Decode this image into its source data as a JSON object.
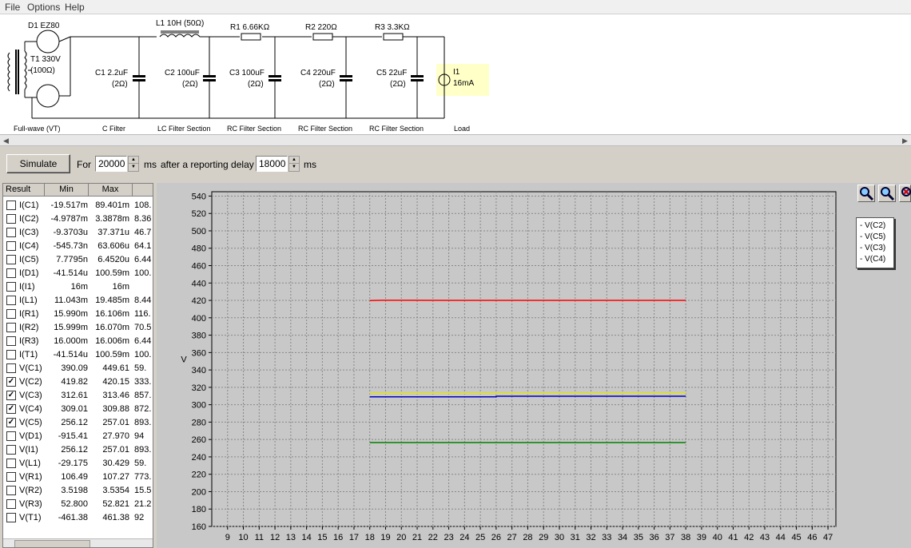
{
  "menu": [
    "File",
    "Options",
    "Help"
  ],
  "schematic": {
    "d1": "D1 EZ80",
    "t1a": "T1 330V",
    "t1b": "(100Ω)",
    "l1": "L1 10H (50Ω)",
    "r1": "R1 6.66KΩ",
    "r2": "R2 220Ω",
    "r3": "R3 3.3KΩ",
    "c1a": "C1 2.2uF",
    "c1b": "(2Ω)",
    "c2a": "C2 100uF",
    "c2b": "(2Ω)",
    "c3a": "C3 100uF",
    "c3b": "(2Ω)",
    "c4a": "C4 220uF",
    "c4b": "(2Ω)",
    "c5a": "C5 22uF",
    "c5b": "(2Ω)",
    "i1a": "I1",
    "i1b": "16mA",
    "sections": [
      "Full-wave (VT)",
      "C Filter",
      "LC Filter Section",
      "RC Filter Section",
      "RC Filter Section",
      "RC Filter Section",
      "Load"
    ]
  },
  "controls": {
    "simulate": "Simulate",
    "for_label": "For",
    "duration": "20000",
    "ms1": "ms",
    "delay_label": "after a reporting delay of",
    "delay": "18000",
    "ms2": "ms"
  },
  "table": {
    "headers": [
      "Result",
      "Min",
      "Max"
    ],
    "rows": [
      {
        "name": "I(C1)",
        "min": "-19.517m",
        "max": "89.401m",
        "extra": "108.",
        "checked": false
      },
      {
        "name": "I(C2)",
        "min": "-4.9787m",
        "max": "3.3878m",
        "extra": "8.36",
        "checked": false
      },
      {
        "name": "I(C3)",
        "min": "-9.3703u",
        "max": "37.371u",
        "extra": "46.7",
        "checked": false
      },
      {
        "name": "I(C4)",
        "min": "-545.73n",
        "max": "63.606u",
        "extra": "64.1",
        "checked": false
      },
      {
        "name": "I(C5)",
        "min": "7.7795n",
        "max": "6.4520u",
        "extra": "6.44",
        "checked": false
      },
      {
        "name": "I(D1)",
        "min": "-41.514u",
        "max": "100.59m",
        "extra": "100.",
        "checked": false
      },
      {
        "name": "I(I1)",
        "min": "16m",
        "max": "16m",
        "extra": "",
        "checked": false
      },
      {
        "name": "I(L1)",
        "min": "11.043m",
        "max": "19.485m",
        "extra": "8.44",
        "checked": false
      },
      {
        "name": "I(R1)",
        "min": "15.990m",
        "max": "16.106m",
        "extra": "116.",
        "checked": false
      },
      {
        "name": "I(R2)",
        "min": "15.999m",
        "max": "16.070m",
        "extra": "70.5",
        "checked": false
      },
      {
        "name": "I(R3)",
        "min": "16.000m",
        "max": "16.006m",
        "extra": "6.44",
        "checked": false
      },
      {
        "name": "I(T1)",
        "min": "-41.514u",
        "max": "100.59m",
        "extra": "100.",
        "checked": false
      },
      {
        "name": "V(C1)",
        "min": "390.09",
        "max": "449.61",
        "extra": "59.",
        "checked": false
      },
      {
        "name": "V(C2)",
        "min": "419.82",
        "max": "420.15",
        "extra": "333.",
        "checked": true
      },
      {
        "name": "V(C3)",
        "min": "312.61",
        "max": "313.46",
        "extra": "857.",
        "checked": true
      },
      {
        "name": "V(C4)",
        "min": "309.01",
        "max": "309.88",
        "extra": "872.",
        "checked": true
      },
      {
        "name": "V(C5)",
        "min": "256.12",
        "max": "257.01",
        "extra": "893.",
        "checked": true
      },
      {
        "name": "V(D1)",
        "min": "-915.41",
        "max": "27.970",
        "extra": "94",
        "checked": false
      },
      {
        "name": "V(I1)",
        "min": "256.12",
        "max": "257.01",
        "extra": "893.",
        "checked": false
      },
      {
        "name": "V(L1)",
        "min": "-29.175",
        "max": "30.429",
        "extra": "59.",
        "checked": false
      },
      {
        "name": "V(R1)",
        "min": "106.49",
        "max": "107.27",
        "extra": "773.",
        "checked": false
      },
      {
        "name": "V(R2)",
        "min": "3.5198",
        "max": "3.5354",
        "extra": "15.5",
        "checked": false
      },
      {
        "name": "V(R3)",
        "min": "52.800",
        "max": "52.821",
        "extra": "21.2",
        "checked": false
      },
      {
        "name": "V(T1)",
        "min": "-461.38",
        "max": "461.38",
        "extra": "92",
        "checked": false
      }
    ]
  },
  "chart_data": {
    "type": "line",
    "ylabel": "V",
    "xlabel": "",
    "xlim": [
      8,
      47.5
    ],
    "ylim": [
      160,
      545
    ],
    "xticks": [
      9,
      10,
      11,
      12,
      13,
      14,
      15,
      16,
      17,
      18,
      19,
      20,
      21,
      22,
      23,
      24,
      25,
      26,
      27,
      28,
      29,
      30,
      31,
      32,
      33,
      34,
      35,
      36,
      37,
      38,
      39,
      40,
      41,
      42,
      43,
      44,
      45,
      46,
      47
    ],
    "yticks": [
      160,
      180,
      200,
      220,
      240,
      260,
      280,
      300,
      320,
      340,
      360,
      380,
      400,
      420,
      440,
      460,
      480,
      500,
      520,
      540
    ],
    "grid": true,
    "legend_position": "right",
    "series": [
      {
        "name": "V(C2)",
        "color": "#ff0000",
        "x": [
          18,
          18.8,
          23,
          38
        ],
        "y": [
          419.8,
          420.1,
          420.0,
          420.0
        ]
      },
      {
        "name": "V(C5)",
        "color": "#008000",
        "x": [
          18,
          38
        ],
        "y": [
          256.5,
          256.5
        ]
      },
      {
        "name": "V(C3)",
        "color": "#e8e800",
        "x": [
          18,
          38
        ],
        "y": [
          313.0,
          313.0
        ]
      },
      {
        "name": "V(C4)",
        "color": "#0000c0",
        "x": [
          18,
          26,
          26,
          38
        ],
        "y": [
          309.0,
          309.0,
          309.8,
          309.8
        ]
      }
    ]
  }
}
